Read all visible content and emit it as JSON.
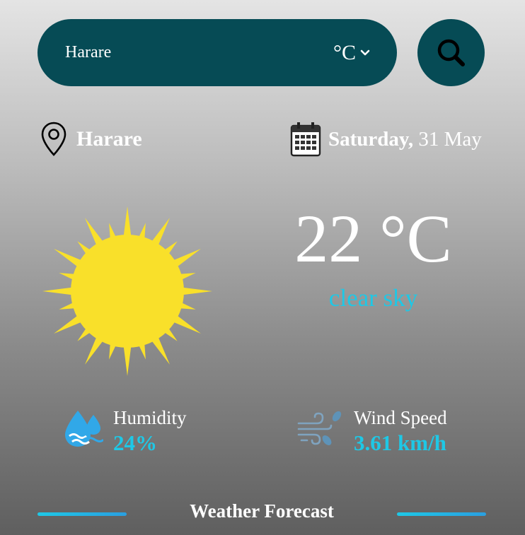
{
  "search": {
    "value": "Harare",
    "unit": "°C"
  },
  "location": {
    "city": "Harare"
  },
  "date": {
    "day": "Saturday,",
    "date": "31 May"
  },
  "current": {
    "temperature": "22 °C",
    "description": "clear sky",
    "icon": "sun-icon"
  },
  "stats": {
    "humidity": {
      "label": "Humidity",
      "value": "24%",
      "icon": "humidity-icon"
    },
    "wind": {
      "label": "Wind Speed",
      "value": "3.61 km/h",
      "icon": "wind-icon"
    }
  },
  "forecast": {
    "title": "Weather Forecast"
  },
  "colors": {
    "primary": "#064b55",
    "accent": "#1ec8e6",
    "sun": "#f9e02a"
  }
}
